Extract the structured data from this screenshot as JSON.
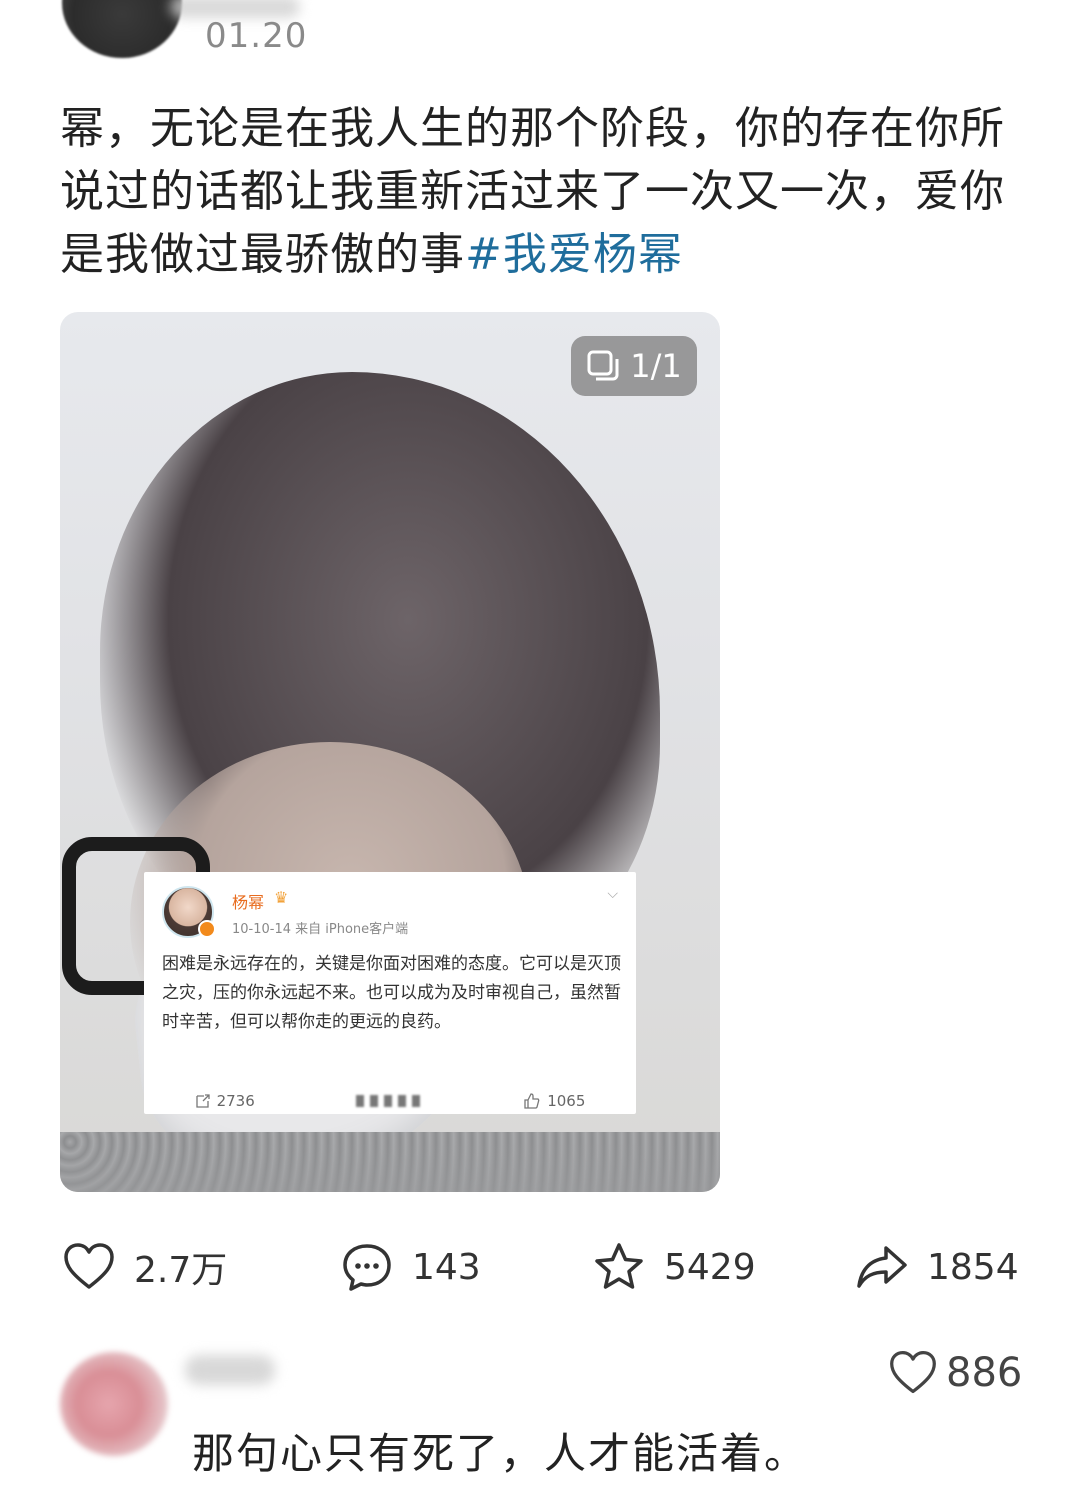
{
  "post": {
    "date": "01.20",
    "text": "幂，无论是在我人生的那个阶段，你的存在你所说过的话都让我重新活过来了一次又一次，爱你是我做过最骄傲的事",
    "hashtag": "#我爱杨幂"
  },
  "image": {
    "page_indicator": "1/1"
  },
  "quoted_post": {
    "author": "杨幂",
    "crown": "♛",
    "meta": "10-10-14  来自 iPhone客户端",
    "body": "困难是永远存在的，关键是你面对困难的态度。它可以是灭顶之灾，压的你永远起不来。也可以成为及时审视自己，虽然暂时辛苦，但可以帮你走的更远的良药。",
    "repost_count": "2736",
    "like_count": "1065"
  },
  "actions": {
    "likes": "2.7万",
    "comments": "143",
    "favorites": "5429",
    "shares": "1854"
  },
  "comment": {
    "text": "那句心只有死了，人才能活着。",
    "likes": "886"
  }
}
